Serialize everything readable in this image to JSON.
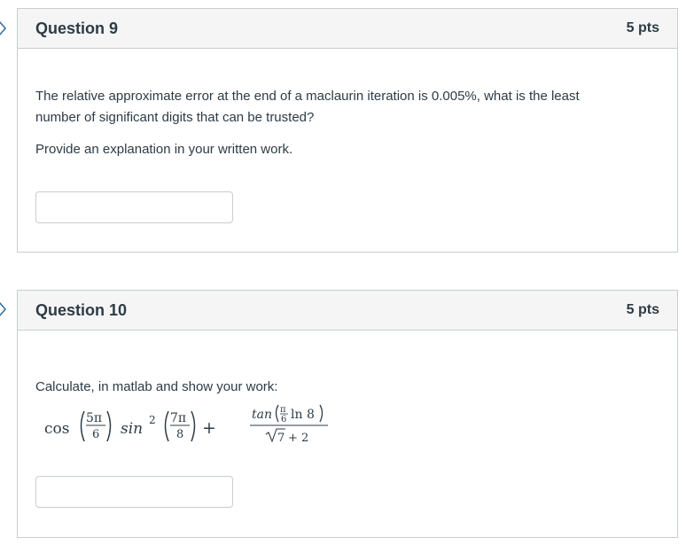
{
  "questions": [
    {
      "title": "Question 9",
      "points": "5 pts",
      "text_line1": "The relative approximate error at the end of a maclaurin iteration is 0.005%, what is the least",
      "text_line2": "number of significant digits that can be trusted?",
      "text_para2": "Provide an explanation in your written work.",
      "answer_value": ""
    },
    {
      "title": "Question 10",
      "points": "5 pts",
      "text": "Calculate, in matlab and show your work:",
      "formula": {
        "cos": "cos",
        "frac1_num": "5π",
        "frac1_den": "6",
        "sin": "sin",
        "sin_exp": "2",
        "frac2_num": "7π",
        "frac2_den": "8",
        "plus": "+",
        "tan": "tan",
        "pi": "π",
        "six": "6",
        "ln8": "ln 8",
        "sqrt_arg": "7",
        "denominator_rest": "+ 2"
      },
      "answer_value": ""
    }
  ],
  "marker_icon": "arrow-marker-icon"
}
